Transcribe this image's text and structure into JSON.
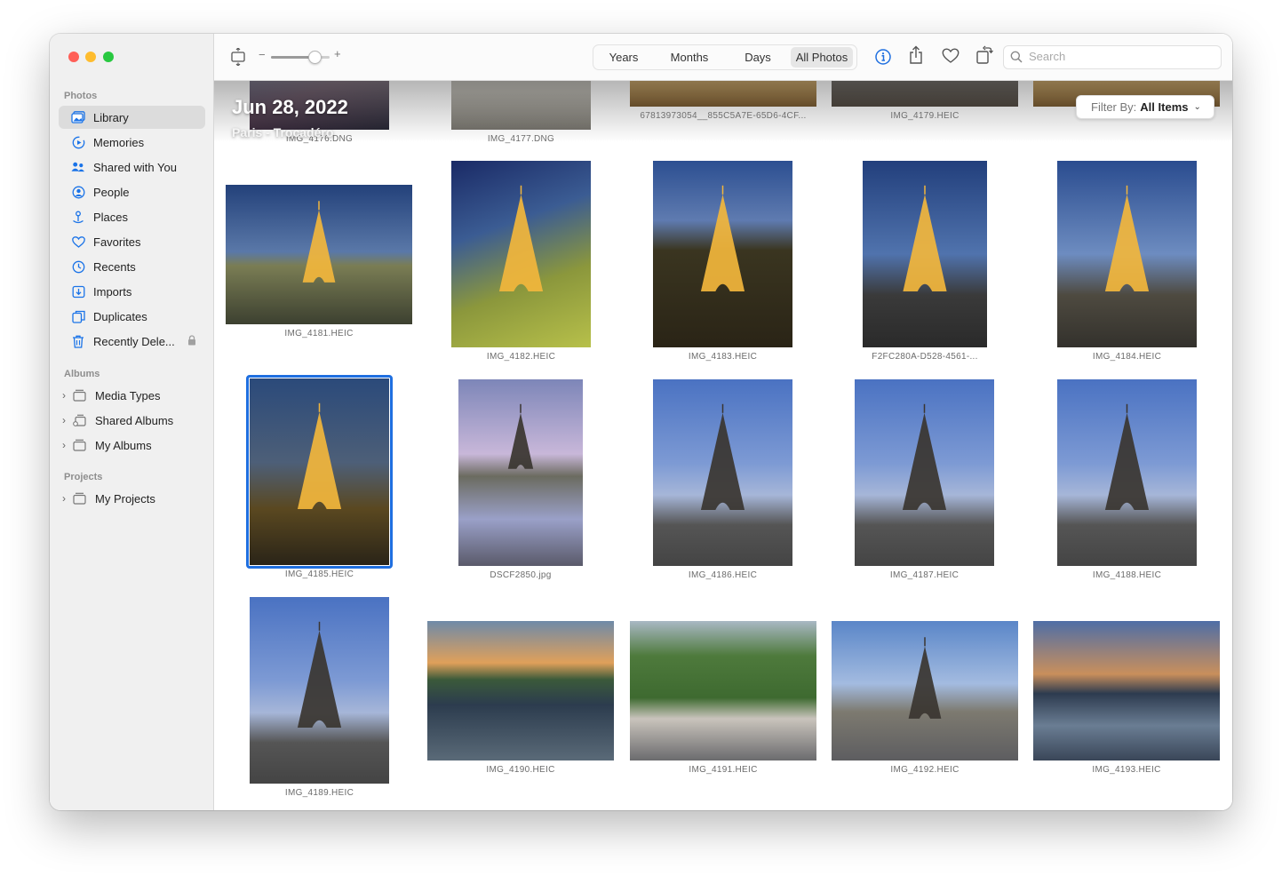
{
  "sidebar": {
    "photos_title": "Photos",
    "items": [
      {
        "label": "Library",
        "icon": "library-icon"
      },
      {
        "label": "Memories",
        "icon": "memories-icon"
      },
      {
        "label": "Shared with You",
        "icon": "shared-with-you-icon"
      },
      {
        "label": "People",
        "icon": "people-icon"
      },
      {
        "label": "Places",
        "icon": "places-icon"
      },
      {
        "label": "Favorites",
        "icon": "heart-icon"
      },
      {
        "label": "Recents",
        "icon": "clock-icon"
      },
      {
        "label": "Imports",
        "icon": "imports-icon"
      },
      {
        "label": "Duplicates",
        "icon": "duplicates-icon"
      },
      {
        "label": "Recently Dele...",
        "icon": "trash-icon"
      }
    ],
    "albums_title": "Albums",
    "albums": [
      {
        "label": "Media Types"
      },
      {
        "label": "Shared Albums"
      },
      {
        "label": "My Albums"
      }
    ],
    "projects_title": "Projects",
    "projects": [
      {
        "label": "My Projects"
      }
    ]
  },
  "toolbar": {
    "zoom_minus": "−",
    "zoom_plus": "+",
    "zoom_level": 0.6,
    "segments": [
      "Years",
      "Months",
      "Days",
      "All Photos"
    ],
    "active_segment": "All Photos",
    "search_placeholder": "Search"
  },
  "header": {
    "date": "Jun 28, 2022",
    "location": "Paris - Trocadéro",
    "filter_prefix": "Filter By:",
    "filter_value": "All Items"
  },
  "photos": [
    {
      "caption": "IMG_4176.DNG"
    },
    {
      "caption": "IMG_4177.DNG"
    },
    {
      "caption": "67813973054__855C5A7E-65D6-4CF..."
    },
    {
      "caption": "IMG_4179.HEIC"
    },
    {
      "caption": ""
    },
    {
      "caption": "IMG_4181.HEIC"
    },
    {
      "caption": "IMG_4182.HEIC"
    },
    {
      "caption": "IMG_4183.HEIC"
    },
    {
      "caption": "F2FC280A-D528-4561-..."
    },
    {
      "caption": "IMG_4184.HEIC"
    },
    {
      "caption": "IMG_4185.HEIC"
    },
    {
      "caption": "DSCF2850.jpg"
    },
    {
      "caption": "IMG_4186.HEIC"
    },
    {
      "caption": "IMG_4187.HEIC"
    },
    {
      "caption": "IMG_4188.HEIC"
    },
    {
      "caption": "IMG_4189.HEIC"
    },
    {
      "caption": "IMG_4190.HEIC"
    },
    {
      "caption": "IMG_4191.HEIC"
    },
    {
      "caption": "IMG_4192.HEIC"
    },
    {
      "caption": "IMG_4193.HEIC"
    }
  ],
  "colors": {
    "accent": "#1f6fe0",
    "traffic_red": "#ff5f57",
    "traffic_yellow": "#febc2e",
    "traffic_green": "#28c840"
  }
}
